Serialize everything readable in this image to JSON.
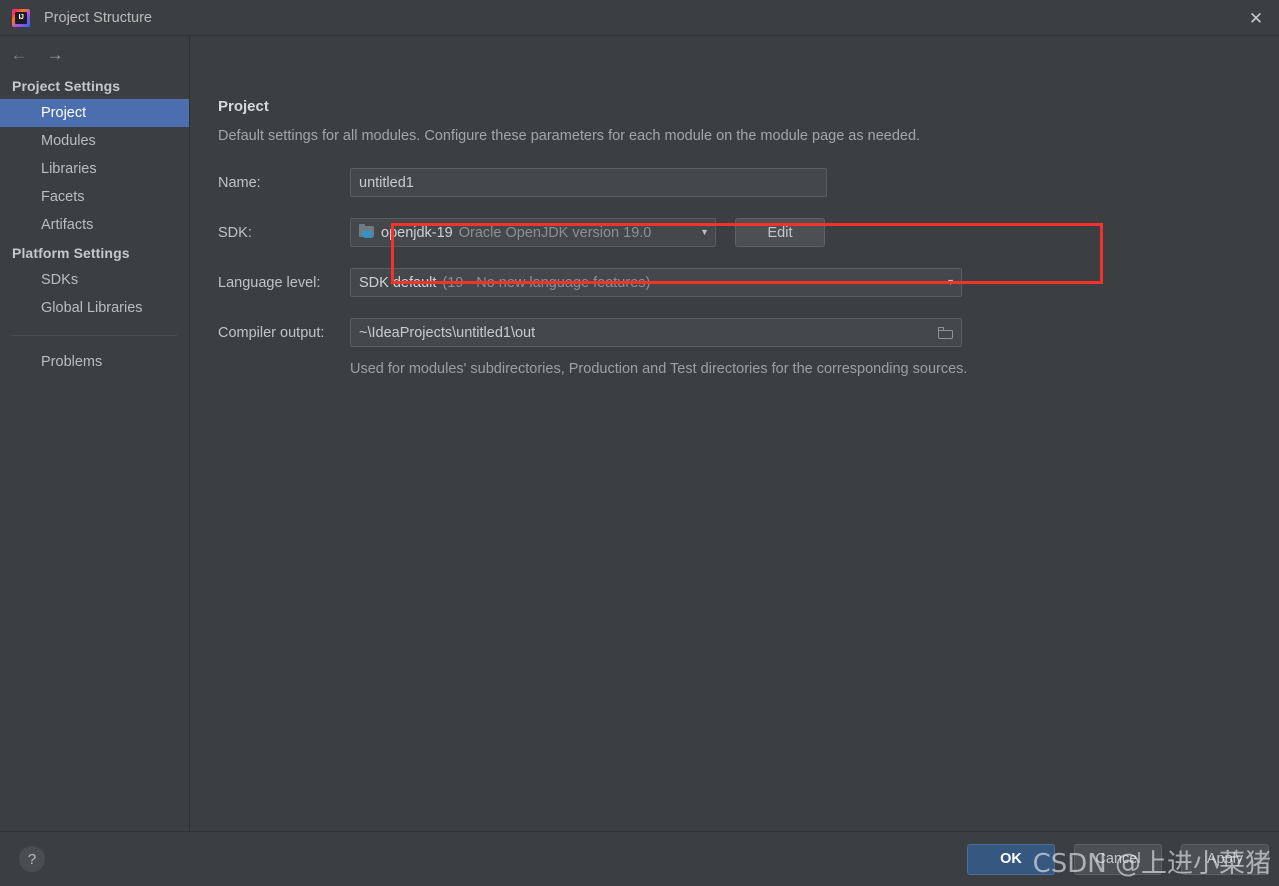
{
  "window": {
    "title": "Project Structure",
    "app_icon": "intellij-idea-icon",
    "close_icon": "✕"
  },
  "nav": {
    "back_icon": "←",
    "forward_icon": "→"
  },
  "sidebar": {
    "groups": [
      {
        "label": "Project Settings",
        "items": [
          {
            "label": "Project",
            "selected": true
          },
          {
            "label": "Modules",
            "selected": false
          },
          {
            "label": "Libraries",
            "selected": false
          },
          {
            "label": "Facets",
            "selected": false
          },
          {
            "label": "Artifacts",
            "selected": false
          }
        ]
      },
      {
        "label": "Platform Settings",
        "items": [
          {
            "label": "SDKs",
            "selected": false
          },
          {
            "label": "Global Libraries",
            "selected": false
          }
        ]
      }
    ],
    "problems": {
      "label": "Problems"
    }
  },
  "main": {
    "heading": "Project",
    "description": "Default settings for all modules. Configure these parameters for each module on the module page as needed.",
    "name": {
      "label": "Name:",
      "value": "untitled1"
    },
    "sdk": {
      "label": "SDK:",
      "icon": "jdk-folder-icon",
      "value": "openjdk-19",
      "hint": "Oracle OpenJDK version 19.0",
      "arrow": "▼",
      "edit_label": "Edit"
    },
    "language_level": {
      "label": "Language level:",
      "value": "SDK default",
      "hint": "(19 - No new language features)",
      "arrow": "▼"
    },
    "compiler_output": {
      "label": "Compiler output:",
      "value": "~\\IdeaProjects\\untitled1\\out",
      "browse_icon": "folder-browse-icon",
      "help": "Used for modules' subdirectories, Production and Test directories for the corresponding sources."
    }
  },
  "footer": {
    "help_icon": "?",
    "ok_label": "OK",
    "cancel_label": "Cancel",
    "apply_label": "Apply"
  },
  "watermark": {
    "text": "CSDN @上进小菜猪"
  },
  "colors": {
    "window_bg": "#3c3f41",
    "selection_blue": "#4b6eaf",
    "ok_button_blue": "#365880",
    "field_bg": "#45484a",
    "annotation_red": "#f3322c",
    "text_primary": "#bfc3c6",
    "text_muted": "#8b9094"
  }
}
